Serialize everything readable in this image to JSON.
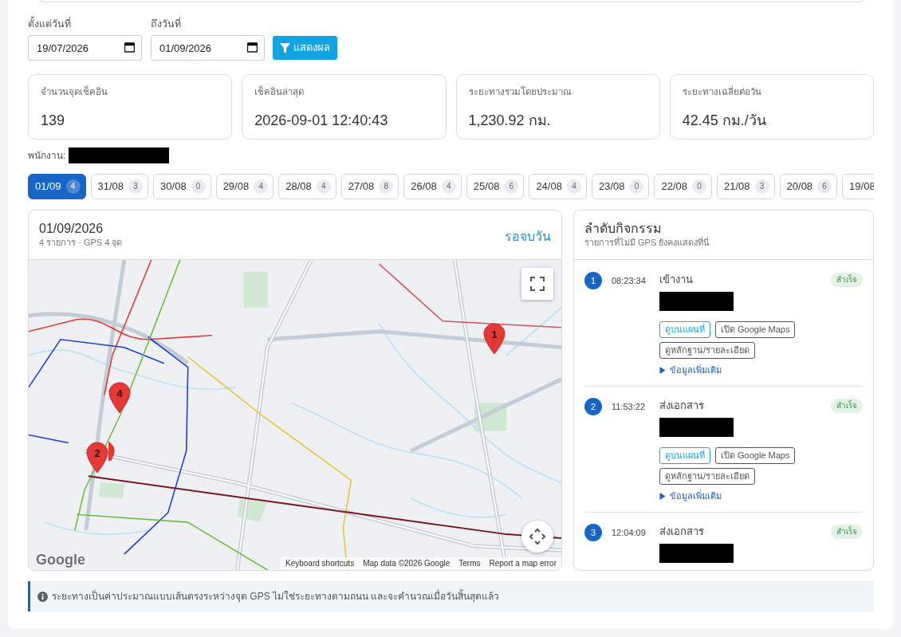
{
  "filters": {
    "from": {
      "label": "ตั้งแต่วันที่",
      "value": "19/07/2026"
    },
    "to": {
      "label": "ถึงวันที่",
      "value": "01/09/2026"
    },
    "submit": {
      "label": "แสดงผล"
    }
  },
  "stats": [
    {
      "label": "จำนวนจุดเช็คอิน",
      "value": "139"
    },
    {
      "label": "เช็คอินล่าสุด",
      "value": "2026-09-01 12:40:43"
    },
    {
      "label": "ระยะทางรวมโดยประมาณ",
      "value": "1,230.92 กม."
    },
    {
      "label": "ระยะทางเฉลี่ยต่อวัน",
      "value": "42.45 กม./วัน"
    }
  ],
  "employee": {
    "label": "พนักงาน:",
    "redacted": true
  },
  "days": [
    {
      "label": "01/09",
      "count": "4",
      "selected": true
    },
    {
      "label": "31/08",
      "count": "3",
      "selected": false
    },
    {
      "label": "30/08",
      "count": "0",
      "selected": false
    },
    {
      "label": "29/08",
      "count": "4",
      "selected": false
    },
    {
      "label": "28/08",
      "count": "4",
      "selected": false
    },
    {
      "label": "27/08",
      "count": "8",
      "selected": false
    },
    {
      "label": "26/08",
      "count": "4",
      "selected": false
    },
    {
      "label": "25/08",
      "count": "6",
      "selected": false
    },
    {
      "label": "24/08",
      "count": "4",
      "selected": false
    },
    {
      "label": "23/08",
      "count": "0",
      "selected": false
    },
    {
      "label": "22/08",
      "count": "0",
      "selected": false
    },
    {
      "label": "21/08",
      "count": "3",
      "selected": false
    },
    {
      "label": "20/08",
      "count": "6",
      "selected": false
    },
    {
      "label": "19/08",
      "selected": false
    }
  ],
  "map_panel": {
    "title": "01/09/2026",
    "subtitle": "4 รายการ · GPS 4 จุด",
    "link": "รอจบวัน",
    "markers": [
      {
        "kind": "pin",
        "label": "1"
      },
      {
        "kind": "pin",
        "label": "2"
      },
      {
        "kind": "pin"
      },
      {
        "kind": "pin",
        "label": "4"
      }
    ],
    "logo": "Google",
    "attribution": [
      "Keyboard shortcuts",
      "Map data ©2026 Google",
      "Terms",
      "Report a map error"
    ]
  },
  "activity_panel": {
    "title": "ลำดับกิจกรรม",
    "subtitle": "รายการที่ไม่มี GPS ยังคงแสดงที่นี่",
    "items": [
      {
        "number": "1",
        "time": "08:23:34",
        "title": "เข้างาน",
        "status": {
          "label": "สำเร็จ",
          "kind": "success"
        },
        "detail_redacted": true,
        "actions": [
          {
            "label": "ดูบนแผนที่",
            "kind": "primary"
          },
          {
            "label": "เปิด Google Maps",
            "kind": "secondary"
          },
          {
            "label": "ดูหลักฐาน/รายละเอียด",
            "kind": "secondary"
          }
        ],
        "more": {
          "label": "ข้อมูลเพิ่มเติม",
          "expanded": false
        }
      },
      {
        "number": "2",
        "time": "11:53:22",
        "title": "ส่งเอกสาร",
        "status": {
          "label": "สำเร็จ",
          "kind": "success"
        },
        "detail_redacted": true,
        "actions": [
          {
            "label": "ดูบนแผนที่",
            "kind": "primary"
          },
          {
            "label": "เปิด Google Maps",
            "kind": "secondary"
          },
          {
            "label": "ดูหลักฐาน/รายละเอียด",
            "kind": "secondary"
          }
        ],
        "more": {
          "label": "ข้อมูลเพิ่มเติม",
          "expanded": false
        }
      },
      {
        "number": "3",
        "time": "12:04:09",
        "title": "ส่งเอกสาร",
        "status": {
          "label": "สำเร็จ",
          "kind": "success"
        },
        "detail_redacted": true
      }
    ]
  },
  "note": {
    "text": "ระยะทางเป็นค่าประมาณแบบเส้นตรงระหว่างจุด GPS ไม่ใช่ระยะทางตามถนน และจะคำนวณเมื่อวันสิ้นสุดแล้ว"
  }
}
